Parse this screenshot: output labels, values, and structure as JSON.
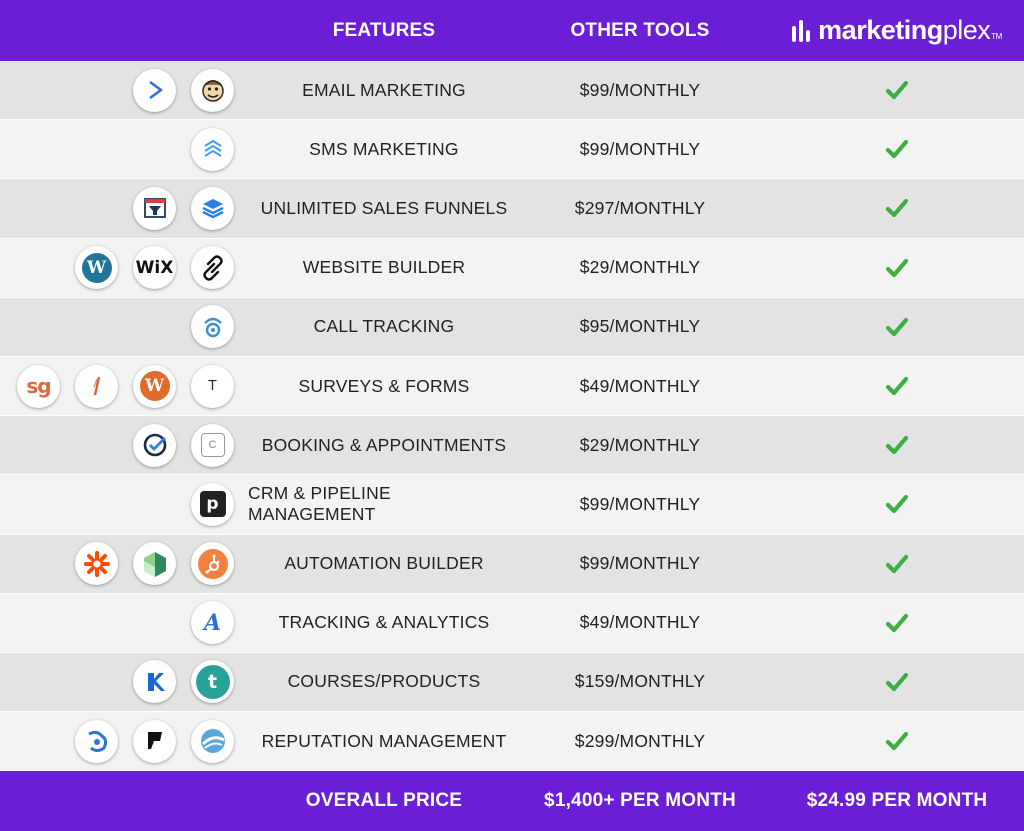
{
  "header": {
    "features_label": "FEATURES",
    "other_tools_label": "OTHER TOOLS",
    "brand": {
      "name_bold": "marketing",
      "name_light": "plex",
      "tm": "TM"
    }
  },
  "colors": {
    "header_bg": "#6a1fd6",
    "row_dark": "#e3e3e3",
    "row_light": "#f3f3f3",
    "check": "#3cb043"
  },
  "rows": [
    {
      "feature": "EMAIL MARKETING",
      "price": "$99/MONTHLY",
      "tools": [
        {
          "icon": "mailchimp-icon"
        },
        {
          "icon": "activecampaign-icon"
        }
      ]
    },
    {
      "feature": "SMS MARKETING",
      "price": "$99/MONTHLY",
      "tools": [
        {
          "icon": "sms-chevrons-icon"
        }
      ]
    },
    {
      "feature": "UNLIMITED SALES FUNNELS",
      "price": "$297/MONTHLY",
      "tools": [
        {
          "icon": "layers-icon"
        },
        {
          "icon": "clickfunnels-icon"
        }
      ]
    },
    {
      "feature": "WEBSITE BUILDER",
      "price": "$29/MONTHLY",
      "tools": [
        {
          "icon": "squarespace-icon"
        },
        {
          "icon": "wix-icon",
          "text": "WiX"
        },
        {
          "icon": "wordpress-icon",
          "text": "W"
        }
      ]
    },
    {
      "feature": "CALL TRACKING",
      "price": "$95/MONTHLY",
      "tools": [
        {
          "icon": "call-tracking-icon"
        }
      ]
    },
    {
      "feature": "SURVEYS & FORMS",
      "price": "$49/MONTHLY",
      "tools": [
        {
          "icon": "typeform-icon",
          "text": "T"
        },
        {
          "icon": "wufoo-icon",
          "text": "W"
        },
        {
          "icon": "formstack-icon"
        },
        {
          "icon": "surveygizmo-icon",
          "text": "sg"
        }
      ]
    },
    {
      "feature": "BOOKING & APPOINTMENTS",
      "price": "$29/MONTHLY",
      "tools": [
        {
          "icon": "calendly-icon",
          "text": "C"
        },
        {
          "icon": "scheduling-check-icon"
        }
      ]
    },
    {
      "feature": "CRM & PIPELINE MANAGEMENT",
      "price": "$99/MONTHLY",
      "tools": [
        {
          "icon": "pipedrive-icon",
          "text": "p"
        }
      ]
    },
    {
      "feature": "AUTOMATION BUILDER",
      "price": "$99/MONTHLY",
      "tools": [
        {
          "icon": "hubspot-icon"
        },
        {
          "icon": "green-cube-icon"
        },
        {
          "icon": "zapier-icon"
        }
      ]
    },
    {
      "feature": "TRACKING & ANALYTICS",
      "price": "$49/MONTHLY",
      "tools": [
        {
          "icon": "analytics-a-icon",
          "text": "A"
        }
      ]
    },
    {
      "feature": "COURSES/PRODUCTS",
      "price": "$159/MONTHLY",
      "tools": [
        {
          "icon": "teachable-icon",
          "text": "t"
        },
        {
          "icon": "kajabi-icon"
        }
      ]
    },
    {
      "feature": "REPUTATION MANAGEMENT",
      "price": "$299/MONTHLY",
      "tools": [
        {
          "icon": "reputation-swirl-icon"
        },
        {
          "icon": "foursquare-icon"
        },
        {
          "icon": "birdeye-icon"
        }
      ]
    }
  ],
  "footer": {
    "overall_label": "OVERALL PRICE",
    "other_total": "$1,400+ PER MONTH",
    "mp_total": "$24.99 PER MONTH"
  }
}
